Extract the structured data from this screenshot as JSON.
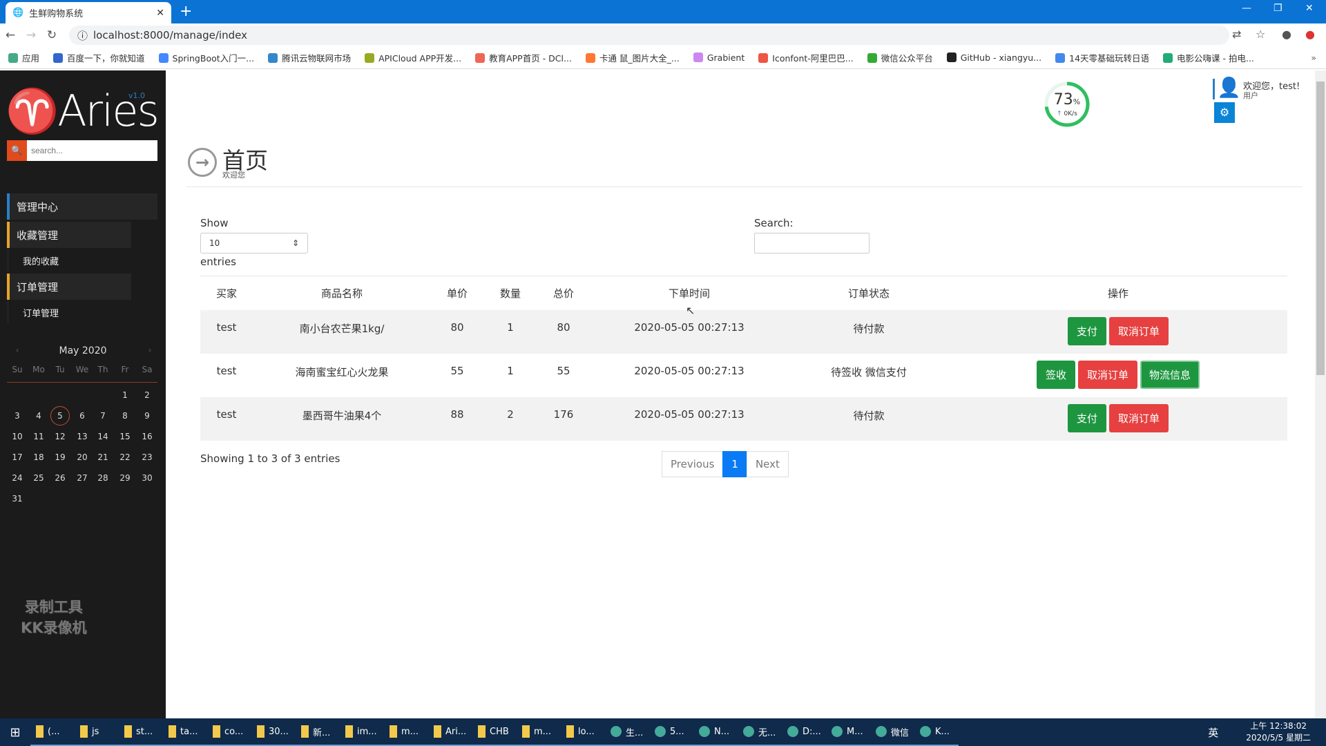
{
  "browser": {
    "tab_title": "生鲜购物系统",
    "url": "localhost:8000/manage/index",
    "bookmarks": [
      "应用",
      "百度一下，你就知道",
      "SpringBoot入门一...",
      "腾讯云物联网市场",
      "APICloud APP开发...",
      "教育APP首页 - DCl...",
      "卡通 鼠_图片大全_...",
      "Grabient",
      "Iconfont-阿里巴巴...",
      "微信公众平台",
      "GitHub - xiangyu...",
      "14天零基础玩转日语",
      "电影公嗨课 - 拍电..."
    ],
    "more": "»"
  },
  "sidebar": {
    "logo": "♈Aries",
    "version": "v1.0",
    "search_placeholder": "search...",
    "menu": [
      {
        "label": "管理中心",
        "color": "#2a7fc8"
      },
      {
        "label": "收藏管理",
        "color": "#e8a32c"
      },
      {
        "label": "我的收藏",
        "sub": true
      },
      {
        "label": "订单管理",
        "color": "#e8a32c"
      },
      {
        "label": "订单管理",
        "sub": true
      }
    ],
    "calendar": {
      "month": "May 2020",
      "weekdays": [
        "Su",
        "Mo",
        "Tu",
        "We",
        "Th",
        "Fr",
        "Sa"
      ],
      "today": 5,
      "days": 31,
      "first_weekday": 5
    },
    "watermark": [
      "录制工具",
      "KK录像机"
    ]
  },
  "header": {
    "gauge_value": "73",
    "gauge_unit": "%",
    "speed": "0K/s",
    "welcome": "欢迎您，test!",
    "role": "用户"
  },
  "page": {
    "title": "首页",
    "subtitle": "欢迎您",
    "show_label": "Show",
    "length_value": "10",
    "entries_label": "entries",
    "search_label": "Search:",
    "columns": [
      "买家",
      "商品名称",
      "单价",
      "数量",
      "总价",
      "下单时间",
      "订单状态",
      "操作"
    ],
    "rows": [
      {
        "buyer": "test",
        "product": "南小台农芒果1kg/",
        "price": "80",
        "qty": "1",
        "total": "80",
        "time": "2020-05-05 00:27:13",
        "status": "待付款",
        "actions": [
          {
            "label": "支付",
            "style": "g"
          },
          {
            "label": "取消订单",
            "style": "r"
          }
        ]
      },
      {
        "buyer": "test",
        "product": "海南蜜宝红心火龙果",
        "price": "55",
        "qty": "1",
        "total": "55",
        "time": "2020-05-05 00:27:13",
        "status": "待签收 微信支付",
        "actions": [
          {
            "label": "签收",
            "style": "g"
          },
          {
            "label": "取消订单",
            "style": "r"
          },
          {
            "label": "物流信息",
            "style": "gf"
          }
        ]
      },
      {
        "buyer": "test",
        "product": "墨西哥牛油果4个",
        "price": "88",
        "qty": "2",
        "total": "176",
        "time": "2020-05-05 00:27:13",
        "status": "待付款",
        "actions": [
          {
            "label": "支付",
            "style": "g"
          },
          {
            "label": "取消订单",
            "style": "r"
          }
        ]
      }
    ],
    "info": "Showing 1 to 3 of 3 entries",
    "prev": "Previous",
    "current_page": "1",
    "next": "Next"
  },
  "taskbar": {
    "items": [
      "(...",
      "js",
      "st...",
      "ta...",
      "co...",
      "30...",
      "新...",
      "im...",
      "m...",
      "Ari...",
      "CHB",
      "m...",
      "lo...",
      "生...",
      "5...",
      "N...",
      "无...",
      "D:...",
      "M...",
      "微信",
      "K..."
    ],
    "ime": "英",
    "time": "上午 12:38:02",
    "date": "2020/5/5 星期二"
  }
}
